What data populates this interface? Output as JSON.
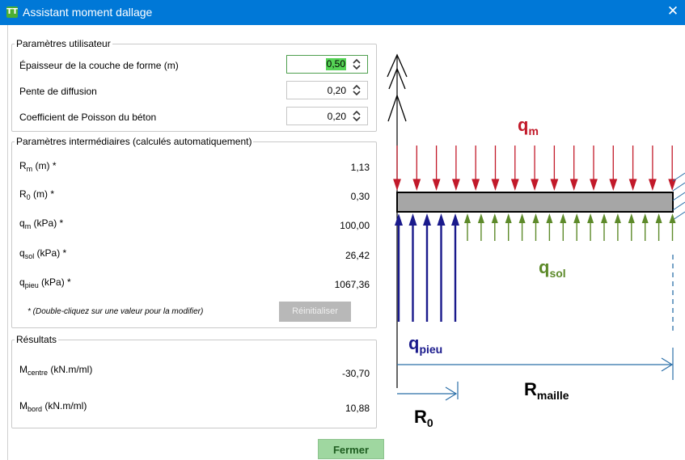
{
  "window": {
    "title": "Assistant moment dallage",
    "close_glyph": "✕"
  },
  "user_params": {
    "legend": "Paramètres utilisateur",
    "fields": [
      {
        "label": "Épaisseur de la couche de forme (m)",
        "value": "0,50"
      },
      {
        "label": "Pente de diffusion",
        "value": "0,20"
      },
      {
        "label": "Coefficient de Poisson du béton",
        "value": "0,20"
      }
    ]
  },
  "intermediate": {
    "legend": "Paramètres intermédiaires (calculés automatiquement)",
    "rows": [
      {
        "sym": "R",
        "sub": "m",
        "unit": " (m) *",
        "value": "1,13"
      },
      {
        "sym": "R",
        "sub": "0",
        "unit": " (m) *",
        "value": "0,30"
      },
      {
        "sym": "q",
        "sub": "m",
        "unit": " (kPa) *",
        "value": "100,00"
      },
      {
        "sym": "q",
        "sub": "sol",
        "unit": " (kPa) *",
        "value": "26,42"
      },
      {
        "sym": "q",
        "sub": "pieu",
        "unit": " (kPa) *",
        "value": "1067,36"
      }
    ],
    "note": "* (Double-cliquez sur une valeur pour la modifier)",
    "reset_label": "Réinitialiser"
  },
  "results": {
    "legend": "Résultats",
    "rows": [
      {
        "sym": "M",
        "sub": "centre",
        "unit": " (kN.m/ml)",
        "value": "-30,70"
      },
      {
        "sym": "M",
        "sub": "bord",
        "unit": " (kN.m/ml)",
        "value": "10,88"
      }
    ]
  },
  "close_label": "Fermer",
  "diagram": {
    "labels": {
      "qm": {
        "main": "q",
        "sub": "m"
      },
      "qsol": {
        "main": "q",
        "sub": "sol"
      },
      "qpieu": {
        "main": "q",
        "sub": "pieu"
      },
      "rmaille": {
        "main": "R",
        "sub": "maille"
      },
      "r0": {
        "main": "R",
        "sub": "0"
      }
    },
    "colors": {
      "qm": "#c21a2a",
      "qsol": "#5d8a2a",
      "qpieu": "#1a1a8c",
      "dim": "#2b6fa8",
      "slab": "#a6a6a6"
    }
  },
  "colors": {
    "titlebar": "#0078d7",
    "accent_green": "#55d455"
  }
}
